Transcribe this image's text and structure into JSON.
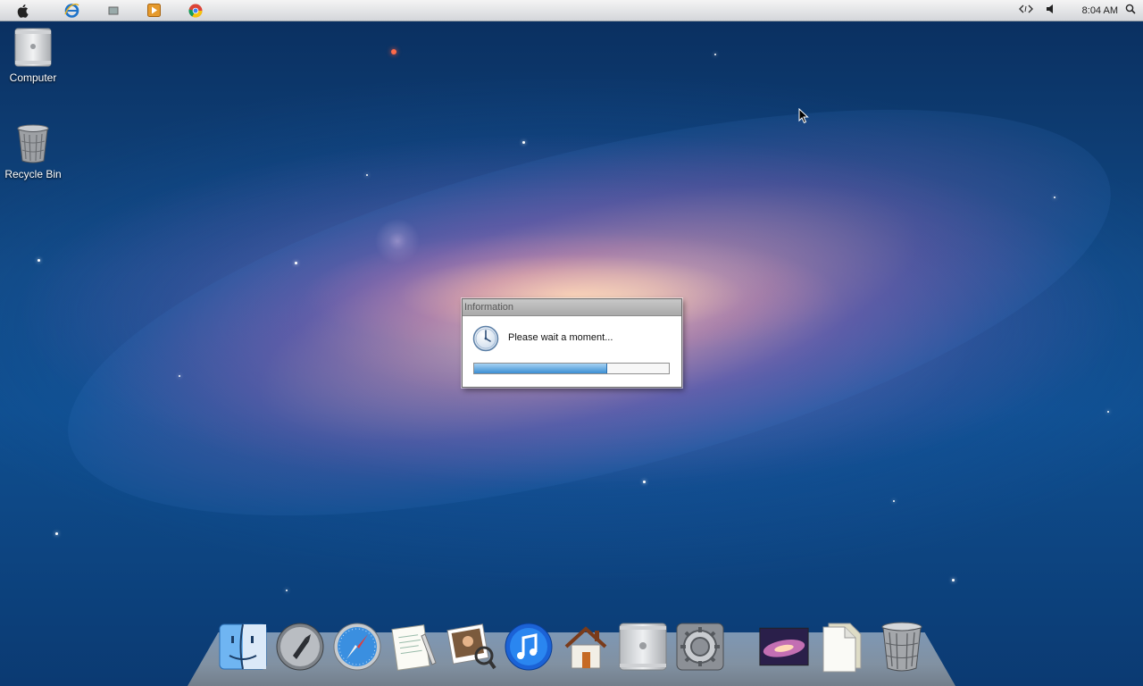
{
  "menubar": {
    "apple_icon": "apple-icon",
    "apps": [
      "internet-explorer-icon",
      "window-icon",
      "media-player-icon",
      "chrome-icon"
    ],
    "clock": "8:04 AM",
    "tray": [
      "network-icon",
      "volume-icon",
      "search-icon"
    ]
  },
  "desktop": {
    "icons": [
      {
        "label": "Computer",
        "icon": "computer-icon"
      },
      {
        "label": "Recycle Bin",
        "icon": "recycle-bin-icon"
      }
    ]
  },
  "dialog": {
    "title": "Information",
    "message": "Please wait a moment...",
    "progress": 0.68
  },
  "dock": {
    "items": [
      "finder-icon",
      "launchpad-icon",
      "safari-icon",
      "textedit-icon",
      "photos-icon",
      "itunes-icon",
      "home-icon",
      "mac-pro-icon",
      "system-preferences-icon",
      "wallpaper-icon",
      "documents-icon",
      "trash-icon"
    ]
  },
  "colors": {
    "menubar": "#d9dbde",
    "progress_fill": "#3b8ed3",
    "desktop_bg": "#114a86"
  }
}
